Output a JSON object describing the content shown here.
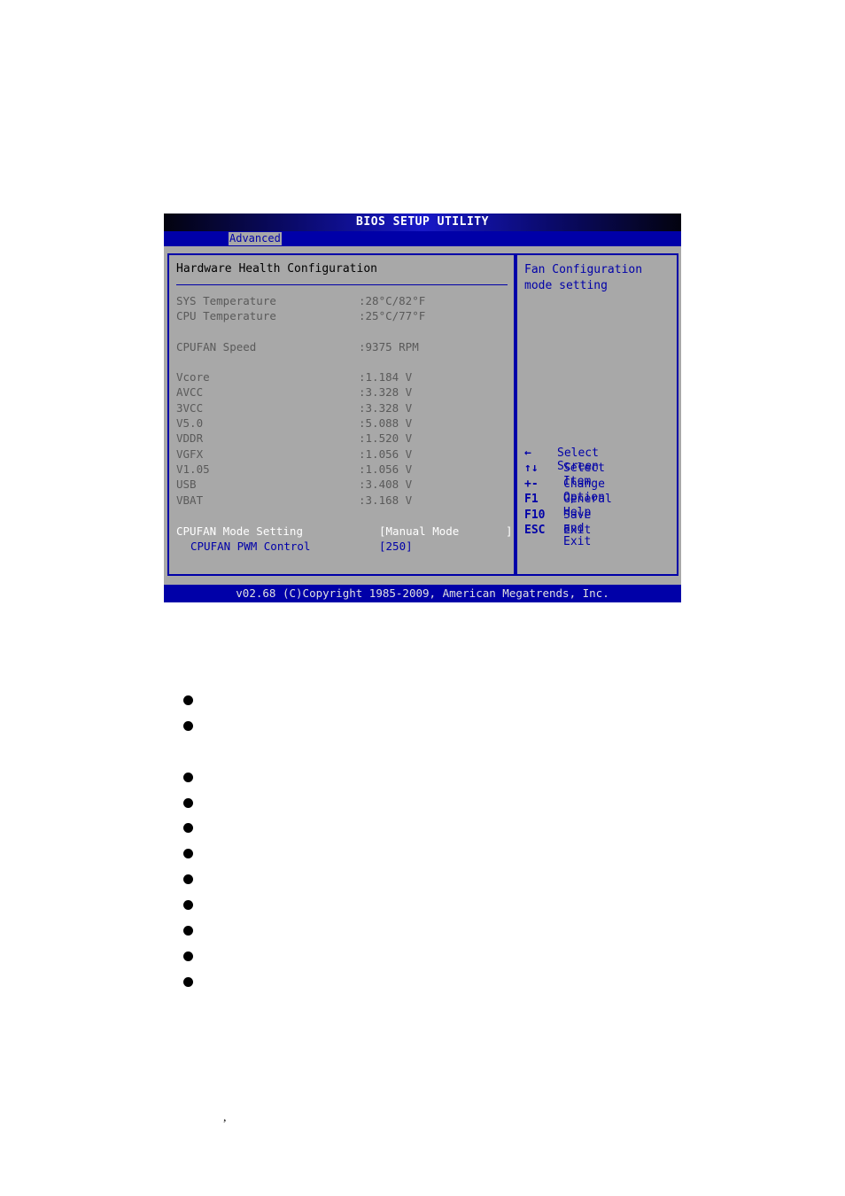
{
  "window": {
    "title": "BIOS SETUP UTILITY"
  },
  "menubar": {
    "active_tab": "Advanced"
  },
  "main": {
    "section_title": "Hardware Health Configuration",
    "readings": [
      {
        "label": "SYS Temperature",
        "value": ":28°C/82°F"
      },
      {
        "label": "CPU Temperature",
        "value": ":25°C/77°F"
      },
      {
        "label": "CPUFAN Speed",
        "value": ":9375 RPM"
      },
      {
        "label": "Vcore",
        "value": ":1.184 V"
      },
      {
        "label": "AVCC",
        "value": ":3.328 V"
      },
      {
        "label": "3VCC",
        "value": ":3.328 V"
      },
      {
        "label": "V5.0",
        "value": ":5.088 V"
      },
      {
        "label": "VDDR",
        "value": ":1.520 V"
      },
      {
        "label": "VGFX",
        "value": ":1.056 V"
      },
      {
        "label": "V1.05",
        "value": ":1.056 V"
      },
      {
        "label": "USB",
        "value": ":3.408 V"
      },
      {
        "label": "VBAT",
        "value": ":3.168 V"
      }
    ],
    "settings": [
      {
        "label": "CPUFAN Mode Setting",
        "value": "[Manual Mode       ]"
      },
      {
        "label": "CPUFAN PWM Control",
        "value": "[250]"
      }
    ]
  },
  "help": {
    "text_line1": "Fan Configuration",
    "text_line2": "mode setting",
    "keys": [
      {
        "key": "←",
        "desc": "Select Screen"
      },
      {
        "key": "↑↓",
        "desc": "Select Item"
      },
      {
        "key": "+-",
        "desc": "Change Option"
      },
      {
        "key": "F1",
        "desc": "General Help"
      },
      {
        "key": "F10",
        "desc": "Save and Exit"
      },
      {
        "key": "ESC",
        "desc": "Exit"
      }
    ]
  },
  "footer": {
    "copyright": "v02.68 (C)Copyright 1985-2009, American Megatrends, Inc."
  },
  "document": {
    "bullet_count": 11,
    "stray_mark": ","
  }
}
